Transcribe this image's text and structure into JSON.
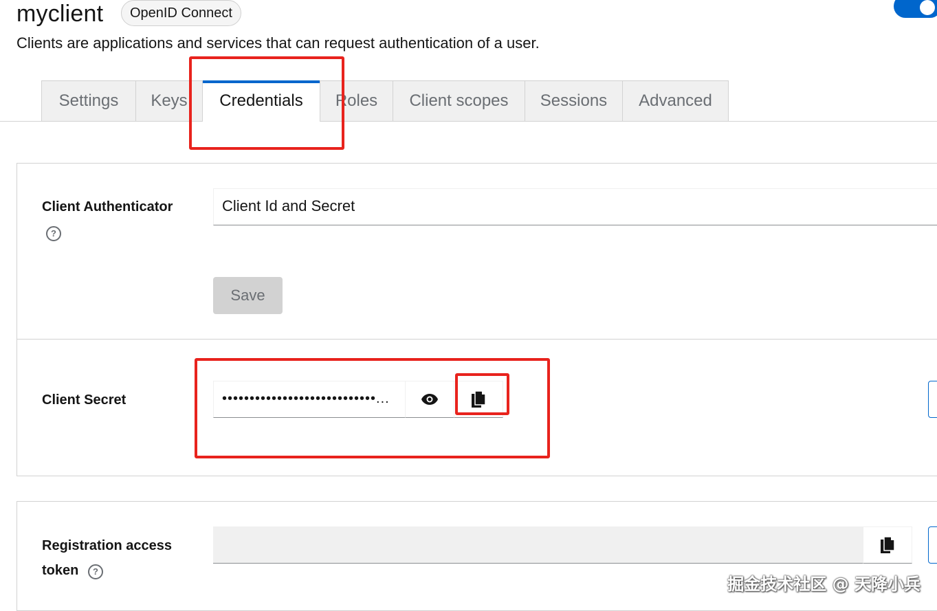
{
  "header": {
    "title": "myclient",
    "protocol_badge": "OpenID Connect",
    "description": "Clients are applications and services that can request authentication of a user.",
    "enabled": true
  },
  "tabs": [
    {
      "label": "Settings",
      "active": false
    },
    {
      "label": "Keys",
      "active": false
    },
    {
      "label": "Credentials",
      "active": true
    },
    {
      "label": "Roles",
      "active": false
    },
    {
      "label": "Client scopes",
      "active": false
    },
    {
      "label": "Sessions",
      "active": false
    },
    {
      "label": "Advanced",
      "active": false
    }
  ],
  "authenticator": {
    "label": "Client Authenticator",
    "value": "Client Id and Secret",
    "save_label": "Save"
  },
  "secret": {
    "label": "Client Secret",
    "masked_value": "••••••••••••••••••••••••••••..."
  },
  "registration": {
    "label_line1": "Registration access",
    "label_line2": "token",
    "value": ""
  },
  "watermark": "掘金技术社区 @ 天降小兵",
  "colors": {
    "accent": "#0066cc",
    "highlight": "#e8231d"
  }
}
